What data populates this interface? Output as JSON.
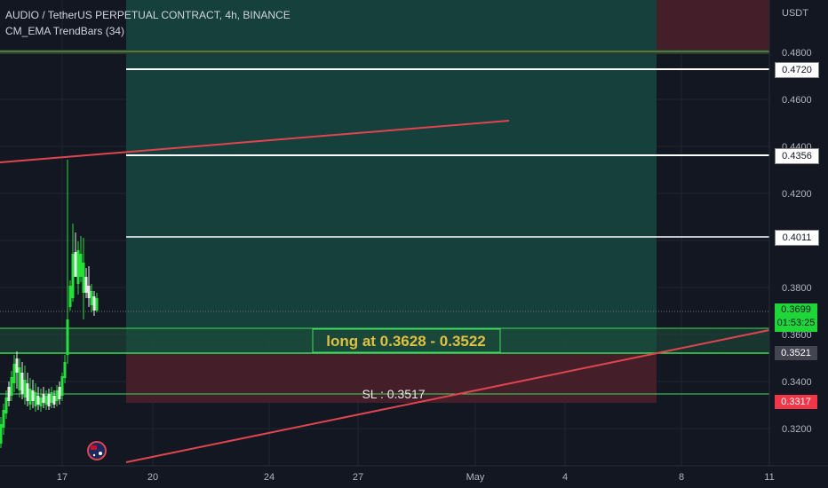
{
  "header": {
    "symbol_line": "AUDIO / TetherUS PERPETUAL CONTRACT, 4h, BINANCE",
    "indicator_line": "CM_EMA TrendBars (34)"
  },
  "axis": {
    "currency": "USDT",
    "price_ticks": [
      "0.4800",
      "0.4600",
      "0.4400",
      "0.4200",
      "0.3800",
      "0.3600",
      "0.3400",
      "0.3200"
    ],
    "time_ticks": [
      "17",
      "20",
      "24",
      "27",
      "May",
      "4",
      "8",
      "11"
    ]
  },
  "badges": {
    "level_0_4720": "0.4720",
    "level_0_4356": "0.4356",
    "level_0_4011": "0.4011",
    "last_price": "0.3699",
    "countdown": "01:53:25",
    "level_0_3521": "0.3521",
    "level_0_3317": "0.3317"
  },
  "annotations": {
    "long_text": "long at 0.3628 - 0.3522",
    "sl_text": "SL : 0.3517"
  },
  "colors": {
    "background": "#131722",
    "up_candle": "#26e03a",
    "down_candle": "#e8e8e8",
    "trendline": "#e0454f",
    "profit_zone": "#17453f",
    "loss_zone": "#4a1f2a",
    "entry_zone_border": "#3ddc5a",
    "long_text": "#e0c040",
    "last_price_badge": "#1fd63a",
    "stop_badge": "#f2364a"
  }
}
